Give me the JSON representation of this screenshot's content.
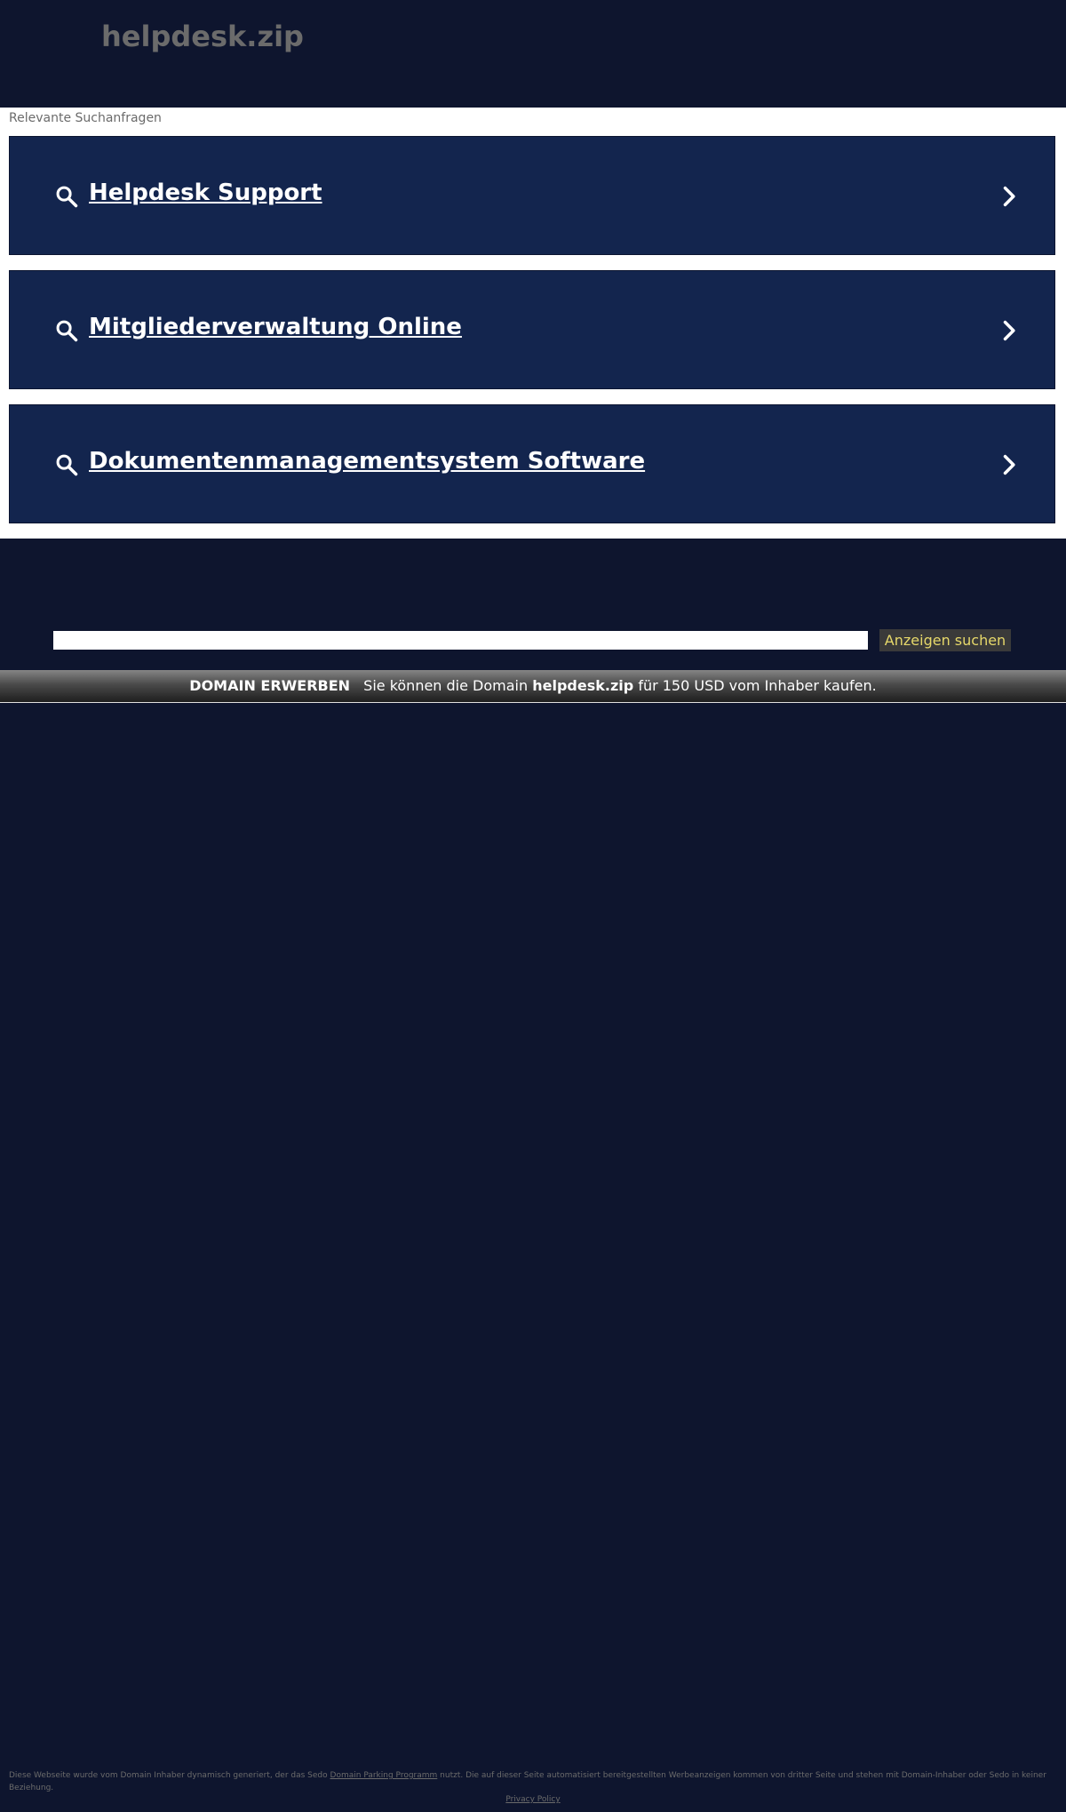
{
  "header": {
    "logo": "helpdesk.zip"
  },
  "results": {
    "label": "Relevante Suchanfragen",
    "items": [
      {
        "label": "Helpdesk Support"
      },
      {
        "label": "Mitgliederverwaltung Online"
      },
      {
        "label": "Dokumentenmanagementsystem Software"
      }
    ]
  },
  "search": {
    "value": "",
    "button_label": "Anzeigen suchen"
  },
  "buy": {
    "label": "DOMAIN ERWERBEN",
    "text_before": "Sie können die Domain",
    "domain": "helpdesk.zip",
    "text_after": "für 150 USD vom Inhaber kaufen."
  },
  "footer": {
    "text_before": "Diese Webseite wurde vom Domain Inhaber dynamisch generiert, der das Sedo",
    "link": "Domain Parking Programm",
    "text_after": "nutzt. Die auf dieser Seite automatisiert bereitgestellten Werbeanzeigen kommen von dritter Seite und stehen mit Domain-Inhaber oder Sedo in keiner Beziehung.",
    "privacy": "Privacy Policy"
  },
  "colors": {
    "background": "#0e152e",
    "result_bg": "#13254e",
    "button_text": "#e6d86a",
    "muted_text": "#6b6b6b"
  },
  "icons": {
    "search": "search-icon",
    "chevron": "chevron-right-icon"
  }
}
